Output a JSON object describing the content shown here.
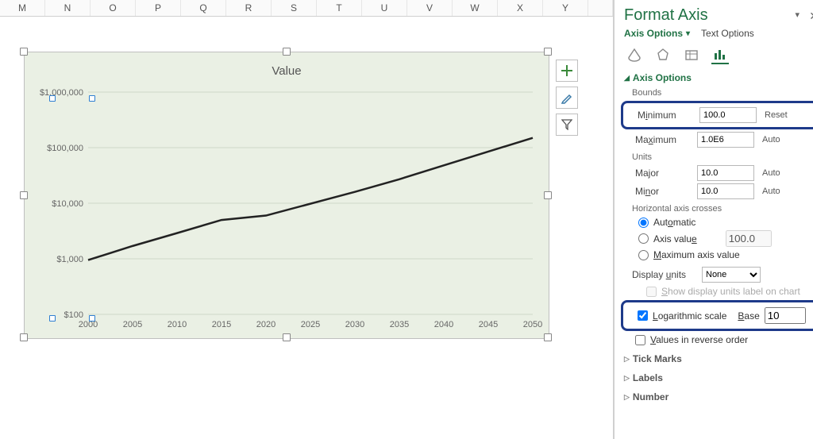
{
  "columns": [
    "M",
    "N",
    "O",
    "P",
    "Q",
    "R",
    "S",
    "T",
    "U",
    "V",
    "W",
    "X",
    "Y",
    ""
  ],
  "chart": {
    "title": "Value"
  },
  "chart_data": {
    "type": "line",
    "title": "Value",
    "xlabel": "",
    "ylabel": "",
    "x": [
      2000,
      2005,
      2010,
      2015,
      2020,
      2025,
      2030,
      2035,
      2040,
      2045,
      2050
    ],
    "xticks": [
      2000,
      2005,
      2010,
      2015,
      2020,
      2025,
      2030,
      2035,
      2040,
      2045,
      2050
    ],
    "series": [
      {
        "name": "Value",
        "values": [
          950,
          1700,
          2900,
          5000,
          6000,
          9800,
          16000,
          27000,
          48000,
          85000,
          150000
        ]
      }
    ],
    "y_scale": "log",
    "y_log_base": 10,
    "ylim": [
      100,
      1000000
    ],
    "yticks": [
      100,
      1000,
      10000,
      100000,
      1000000
    ],
    "ytick_labels": [
      "$100",
      "$1,000",
      "$10,000",
      "$100,000",
      "$1,000,000"
    ]
  },
  "pane": {
    "title": "Format Axis",
    "tabs": {
      "options": "Axis Options",
      "text": "Text Options"
    },
    "section": "Axis Options",
    "bounds": {
      "label": "Bounds",
      "min_label": "Minimum",
      "min_value": "100.0",
      "min_aux": "Reset",
      "max_label": "Maximum",
      "max_value": "1.0E6",
      "max_aux": "Auto"
    },
    "units": {
      "label": "Units",
      "major_label": "Major",
      "major_value": "10.0",
      "major_aux": "Auto",
      "minor_label": "Minor",
      "minor_value": "10.0",
      "minor_aux": "Auto"
    },
    "crosses": {
      "label": "Horizontal axis crosses",
      "auto": "Automatic",
      "axis_value": "Axis value",
      "axis_value_input": "100.0",
      "max": "Maximum axis value"
    },
    "display_units": {
      "label": "Display units",
      "value": "None",
      "show_label": "Show display units label on chart"
    },
    "log": {
      "label": "Logarithmic scale",
      "base_label": "Base",
      "base_value": "10"
    },
    "reverse": "Values in reverse order",
    "collapsed": {
      "tickmarks": "Tick Marks",
      "labels": "Labels",
      "number": "Number"
    }
  }
}
